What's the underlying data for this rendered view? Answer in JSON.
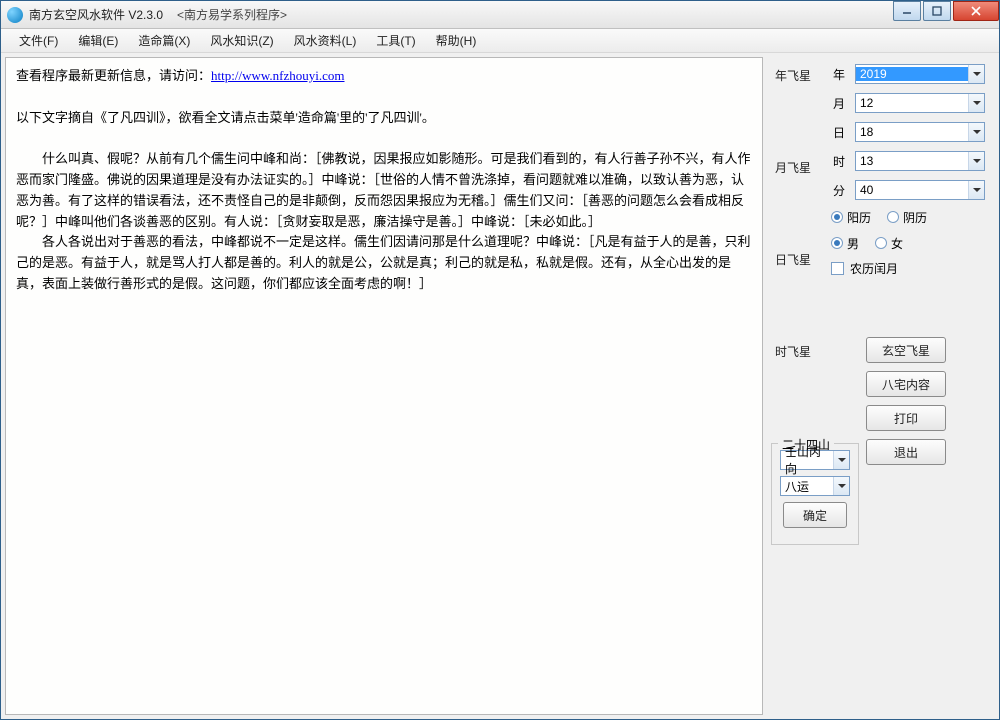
{
  "title": "南方玄空风水软件 V2.3.0",
  "subtitle": "<南方易学系列程序>",
  "menu": [
    "文件(F)",
    "编辑(E)",
    "造命篇(X)",
    "风水知识(Z)",
    "风水资料(L)",
    "工具(T)",
    "帮助(H)"
  ],
  "content": {
    "line1_prefix": "查看程序最新更新信息，请访问：",
    "url": "http://www.nfzhouyi.com",
    "line2": "以下文字摘自《了凡四训》，欲看全文请点击菜单'造命篇'里的'了凡四训'。",
    "para1": "　　什么叫真、假呢？从前有几个儒生问中峰和尚：［佛教说，因果报应如影随形。可是我们看到的，有人行善子孙不兴，有人作恶而家门隆盛。佛说的因果道理是没有办法证实的。］中峰说：［世俗的人情不曾洗涤掉，看问题就难以准确，以致认善为恶，认恶为善。有了这样的错误看法，还不责怪自己的是非颠倒，反而怨因果报应为无稽。］儒生们又问：［善恶的问题怎么会看成相反呢？］中峰叫他们各谈善恶的区别。有人说：［贪财妄取是恶，廉洁操守是善。］中峰说：［未必如此。］",
    "para2": "　　各人各说出对于善恶的看法，中峰都说不一定是这样。儒生们因请问那是什么道理呢？中峰说：［凡是有益于人的是善，只利己的是恶。有益于人，就是骂人打人都是善的。利人的就是公，公就是真；利己的就是私，私就是假。还有，从全心出发的是真，表面上装做行善形式的是假。这问题，你们都应该全面考虑的啊！］"
  },
  "labels": {
    "year_star": "年飞星",
    "month_star": "月飞星",
    "day_star": "日飞星",
    "hour_star": "时飞星",
    "twentyfour": "二十四山",
    "year": "年",
    "month": "月",
    "day": "日",
    "hour": "时",
    "minute": "分",
    "solar": "阳历",
    "lunar": "阴历",
    "male": "男",
    "female": "女",
    "leap": "农历闰月"
  },
  "values": {
    "year": "2019",
    "month": "12",
    "day": "18",
    "hour": "13",
    "minute": "40",
    "direction": "壬山丙向",
    "yun": "八运"
  },
  "buttons": {
    "confirm": "确定",
    "xuankong": "玄空飞星",
    "bazhai": "八宅内容",
    "print": "打印",
    "exit": "退出"
  }
}
